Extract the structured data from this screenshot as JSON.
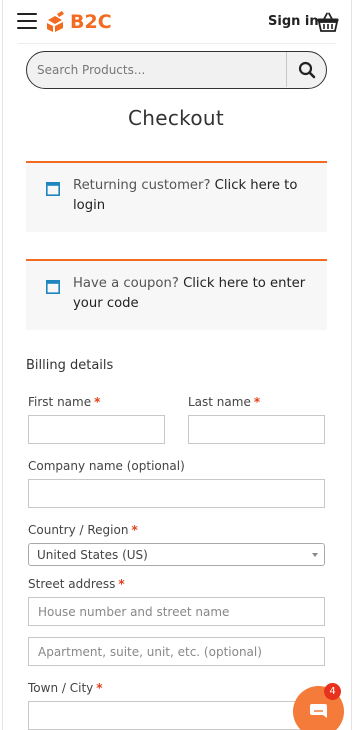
{
  "header": {
    "logo_text": "B2C",
    "signin_label": "Sign in",
    "brand_color": "#f26b21"
  },
  "search": {
    "placeholder": "Search Products..."
  },
  "page": {
    "title": "Checkout"
  },
  "notices": [
    {
      "text": "Returning customer?",
      "link": "Click here to login"
    },
    {
      "text": "Have a coupon?",
      "link": "Click here to enter your code"
    }
  ],
  "billing": {
    "heading": "Billing details",
    "first_name_label": "First name",
    "last_name_label": "Last name",
    "company_label": "Company name (optional)",
    "country_label": "Country / Region",
    "country_value": "United States (US)",
    "street_label": "Street address",
    "street_placeholder": "House number and street name",
    "apartment_placeholder": "Apartment, suite, unit, etc. (optional)",
    "town_label": "Town / City",
    "required_mark": "*"
  },
  "chat": {
    "badge_count": "4",
    "color": "#f47b39"
  }
}
